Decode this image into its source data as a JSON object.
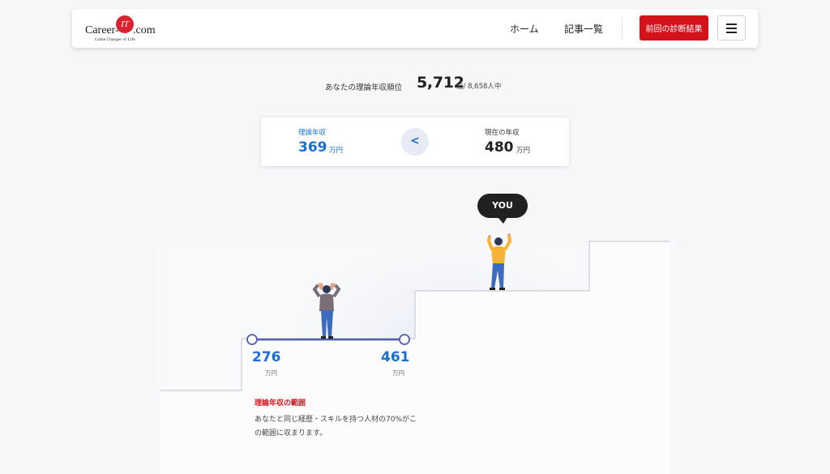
{
  "header": {
    "logo": {
      "word_left": "Career-",
      "word_mark": "IT",
      "word_right": ".com",
      "tagline": "Game Changer of Life"
    },
    "nav": {
      "home": "ホーム",
      "articles": "記事一覧"
    },
    "result_button": "前回の診断結果",
    "menu_icon": "hamburger-menu-icon"
  },
  "rank": {
    "label": "あなたの理論年収順位",
    "value": "5,712",
    "unit": "位/ 8,658人中"
  },
  "compare": {
    "theoretical": {
      "label": "理論年収",
      "value": "369",
      "unit": "万円"
    },
    "current": {
      "label": "現在の年収",
      "value": "480",
      "unit": "万円"
    },
    "symbol": "<"
  },
  "you_label": "YOU",
  "range": {
    "low": "276",
    "low_unit": "万円",
    "high": "461",
    "high_unit": "万円",
    "title": "理論年収の範囲",
    "description": "あなたと同じ経歴・スキルを持つ人材の70%がこの範囲に収まります。"
  },
  "colors": {
    "accent_blue": "#1a6fd1",
    "brand_red": "#d3121c",
    "dark": "#212121"
  }
}
